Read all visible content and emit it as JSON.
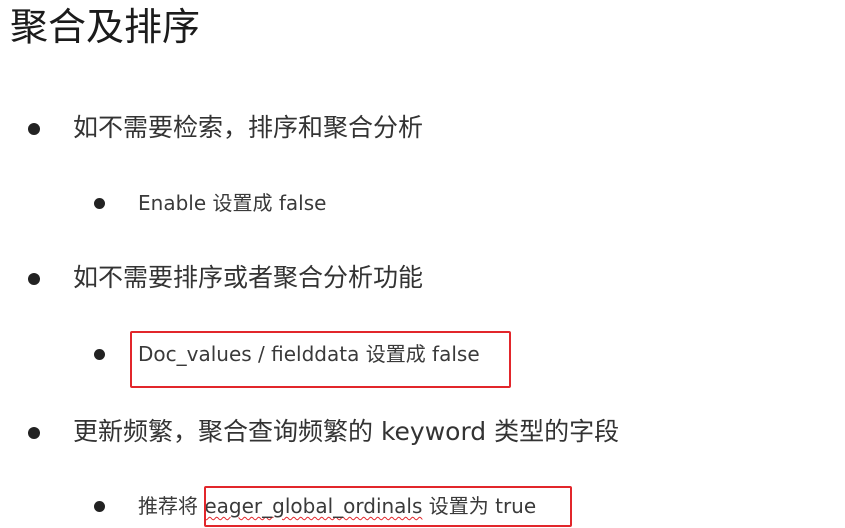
{
  "slide": {
    "title": "聚合及排序",
    "items": [
      {
        "text": "如不需要检索，排序和聚合分析",
        "children": [
          {
            "text": "Enable 设置成 false"
          }
        ]
      },
      {
        "text": "如不需要排序或者聚合分析功能",
        "children": [
          {
            "text": "Doc_values / fielddata 设置成 false",
            "highlighted": true
          }
        ]
      },
      {
        "text": "更新频繁，聚合查询频繁的 keyword 类型的字段",
        "children": [
          {
            "prefix": "推荐将 ",
            "code": "eager_global_ordinals",
            "suffix": " 设置为 true",
            "highlighted": true
          }
        ]
      }
    ]
  },
  "colors": {
    "highlight_border": "#e2262b",
    "text": "#333333",
    "title": "#1b1b1b"
  }
}
